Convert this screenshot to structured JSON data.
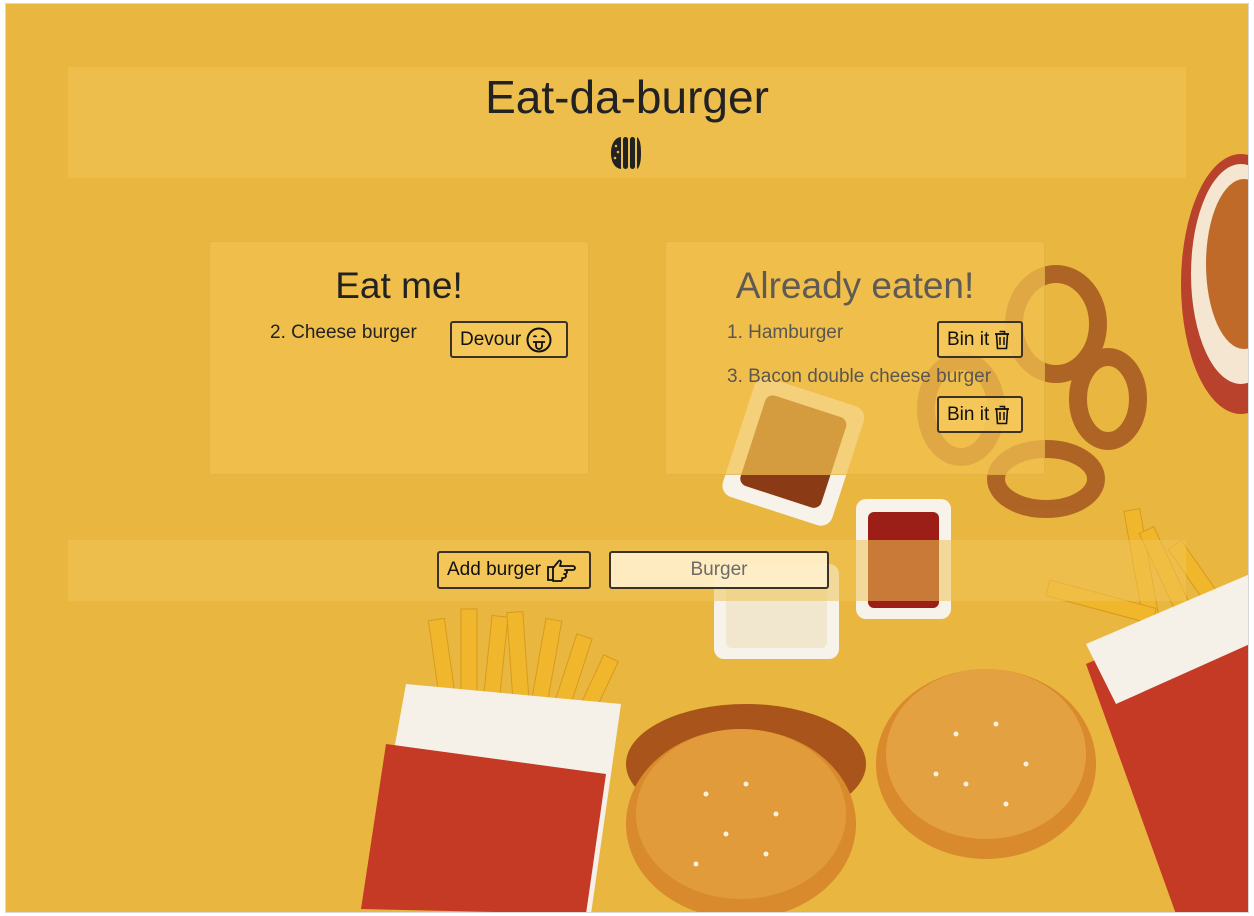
{
  "header": {
    "title": "Eat-da-burger",
    "icon": "burger-icon"
  },
  "eat_me": {
    "title": "Eat me!",
    "items": [
      {
        "label": "2. Cheese burger",
        "button_label": "Devour",
        "button_icon": "tongue-out-face-icon"
      }
    ]
  },
  "already_eaten": {
    "title": "Already eaten!",
    "items": [
      {
        "label": "1. Hamburger",
        "button_label": "Bin it",
        "button_icon": "trash-icon"
      },
      {
        "label": "3. Bacon double cheese burger",
        "button_label": "Bin it",
        "button_icon": "trash-icon"
      }
    ]
  },
  "add_form": {
    "button_label": "Add burger",
    "button_icon": "pointing-hand-icon",
    "input_placeholder": "Burger",
    "input_value": ""
  },
  "colors": {
    "background": "#e9b63f",
    "card": "#f3c250",
    "button_border": "#3a3226"
  }
}
